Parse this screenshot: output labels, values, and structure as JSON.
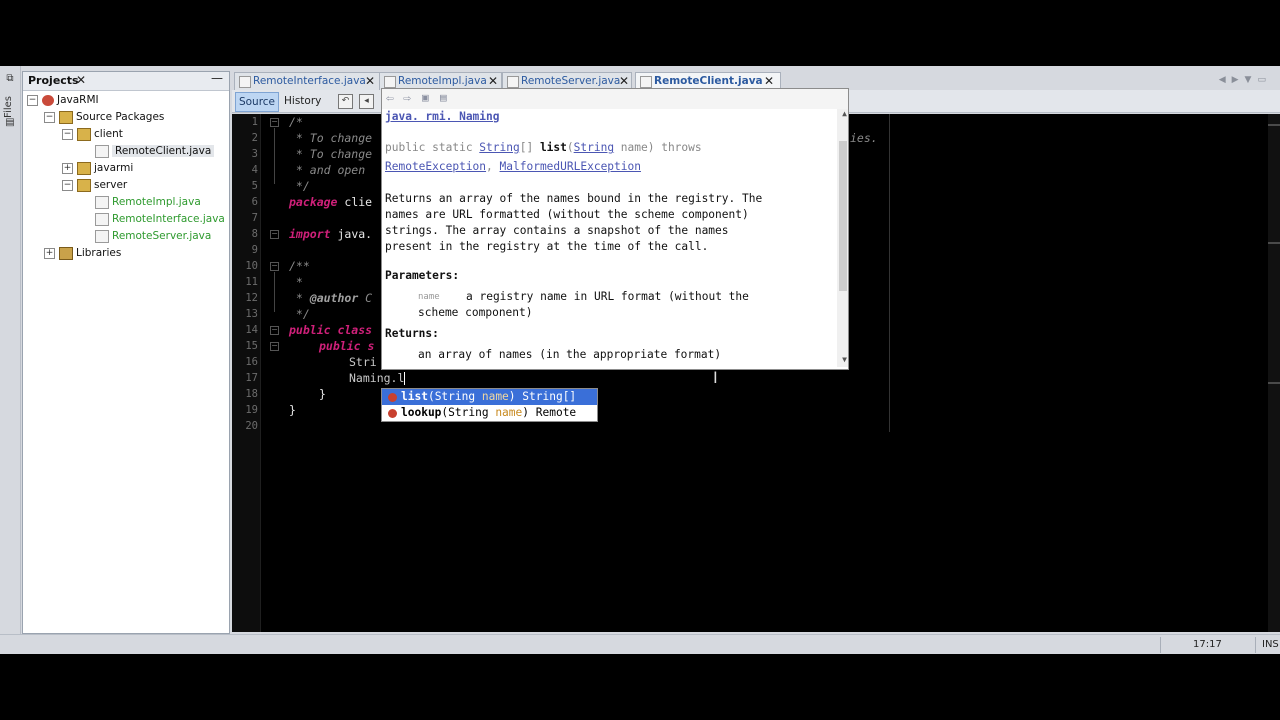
{
  "sidebar": {
    "files_label": "Files"
  },
  "projects": {
    "title": "Projects",
    "tree": [
      {
        "label": "JavaRMI",
        "icon": "project-icon"
      },
      {
        "label": "Source Packages",
        "icon": "package-folder-icon"
      },
      {
        "label": "client",
        "icon": "package-icon"
      },
      {
        "label": "RemoteClient.java",
        "icon": "java-file-icon"
      },
      {
        "label": "javarmi",
        "icon": "package-icon"
      },
      {
        "label": "server",
        "icon": "package-icon"
      },
      {
        "label": "RemoteImpl.java",
        "icon": "java-file-icon"
      },
      {
        "label": "RemoteInterface.java",
        "icon": "java-file-icon"
      },
      {
        "label": "RemoteServer.java",
        "icon": "java-file-icon"
      },
      {
        "label": "Libraries",
        "icon": "libraries-icon"
      }
    ]
  },
  "tabs": [
    {
      "label": "RemoteInterface.java"
    },
    {
      "label": "RemoteImpl.java"
    },
    {
      "label": "RemoteServer.java"
    },
    {
      "label": "RemoteClient.java",
      "active": true
    }
  ],
  "toolbar": {
    "source_label": "Source",
    "history_label": "History"
  },
  "editor": {
    "line_numbers": [
      "1",
      "2",
      "3",
      "4",
      "5",
      "6",
      "7",
      "8",
      "9",
      "10",
      "11",
      "12",
      "13",
      "14",
      "15",
      "16",
      "17",
      "18",
      "19",
      "20"
    ],
    "lines": {
      "l1": "/*",
      "l2": " * To change",
      "l3": " * To change",
      "l4": " * and open",
      "l5": " */",
      "l6_kw": "package",
      "l6_rest": " clie",
      "l8_kw": "import",
      "l8_rest": " java.",
      "l10": "/**",
      "l11": " *",
      "l12_a": " * ",
      "l12_ann": "@author",
      "l12_b": " C",
      "l13": " */",
      "l14_kw": "public class",
      "l15_kw": "public s",
      "l16": "Stri",
      "l17": "Naming.l",
      "l18": "}",
      "l19": "}",
      "right_fragment": "ies."
    }
  },
  "javadoc": {
    "class_link": "java. rmi. Naming",
    "sig_a": "public static ",
    "sig_type": "String",
    "sig_arr": "[] ",
    "sig_name": "list",
    "sig_paren": "(",
    "sig_ptype": "String",
    "sig_rest": " name) throws",
    "exc1": "RemoteException",
    "exc_sep": ", ",
    "exc2": "MalformedURLException",
    "desc": [
      "Returns an array of the names bound in the registry. The",
      "names are URL formatted (without the scheme component)",
      "strings. The array contains a snapshot of the names",
      "present in the registry at the time of the call."
    ],
    "params_label": "Parameters:",
    "param_name": "name",
    "param_desc": [
      "a registry name in URL format (without the",
      "scheme component)"
    ],
    "returns_label": "Returns:",
    "returns_desc": "an array of names (in the appropriate format)"
  },
  "completion": {
    "items": [
      {
        "name": "list",
        "params_open": "(String ",
        "param": "name",
        "params_close": ") ",
        "ret": "String[]",
        "selected": true
      },
      {
        "name": "lookup",
        "params_open": "(String ",
        "param": "name",
        "params_close": ") ",
        "ret": "Remote",
        "selected": false
      }
    ]
  },
  "status": {
    "position": "17:17",
    "mode": "INS"
  }
}
